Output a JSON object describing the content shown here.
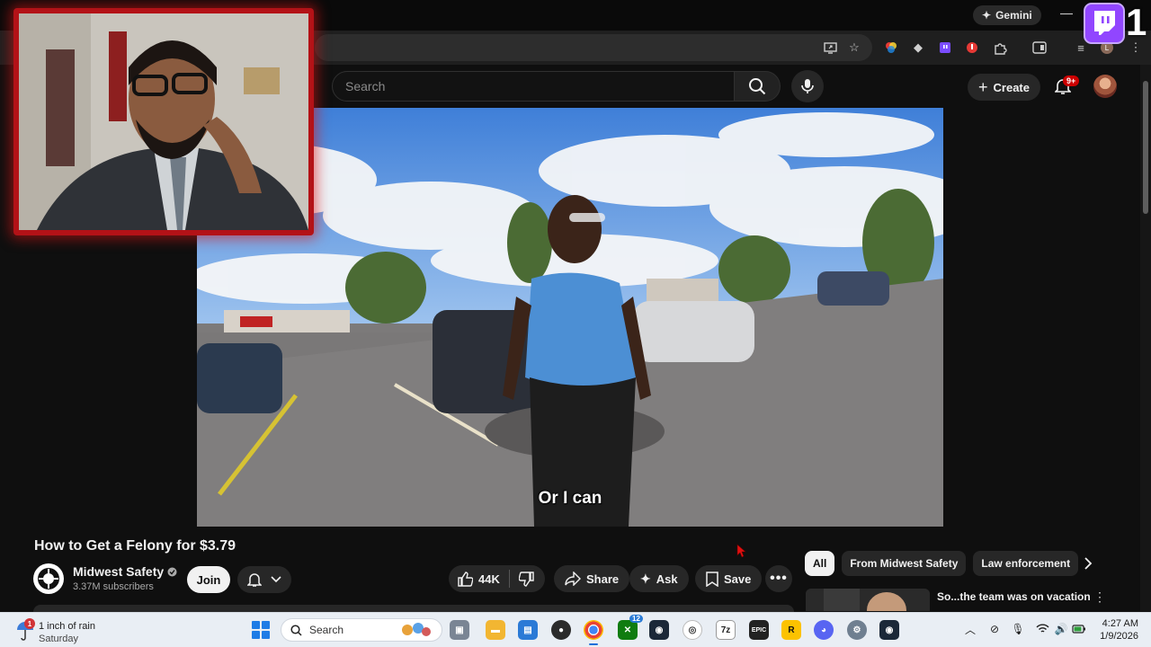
{
  "browser": {
    "gemini_label": "Gemini",
    "extension_icons": [
      "cast-icon",
      "star-icon",
      "colorwheel-extension-icon",
      "diamond-extension-icon",
      "twitch-extension-icon",
      "red-extension-icon",
      "puzzle-icon",
      "sidepanel-icon",
      "media-icon",
      "profile-icon",
      "menu-dots-icon"
    ]
  },
  "youtube": {
    "search_placeholder": "Search",
    "create_label": "Create",
    "notification_count": "9+"
  },
  "video": {
    "caption": "Or I can"
  },
  "overlay": {
    "twitch_number": "1"
  },
  "details": {
    "title": "How to Get a Felony for $3.79",
    "channel_name": "Midwest Safety",
    "subscribers": "3.37M subscribers",
    "join_label": "Join",
    "like_count": "44K",
    "share_label": "Share",
    "ask_label": "Ask",
    "save_label": "Save"
  },
  "chips": [
    {
      "label": "All",
      "active": true
    },
    {
      "label": "From Midwest Safety",
      "active": false
    },
    {
      "label": "Law enforcement",
      "active": false
    }
  ],
  "recommendation": {
    "title": "So...the team was on vacation"
  },
  "taskbar": {
    "weather_line1": "1 inch of rain",
    "weather_line2": "Saturday",
    "weather_badge": "1",
    "search_label": "Search",
    "xbox_badge": "12",
    "time": "4:27 AM",
    "date": "1/9/2026"
  },
  "colors": {
    "youtube_bg": "#0f0f0f",
    "twitch_purple": "#9146ff",
    "cam_border": "#b31217",
    "taskbar_bg": "#e9eef4"
  }
}
